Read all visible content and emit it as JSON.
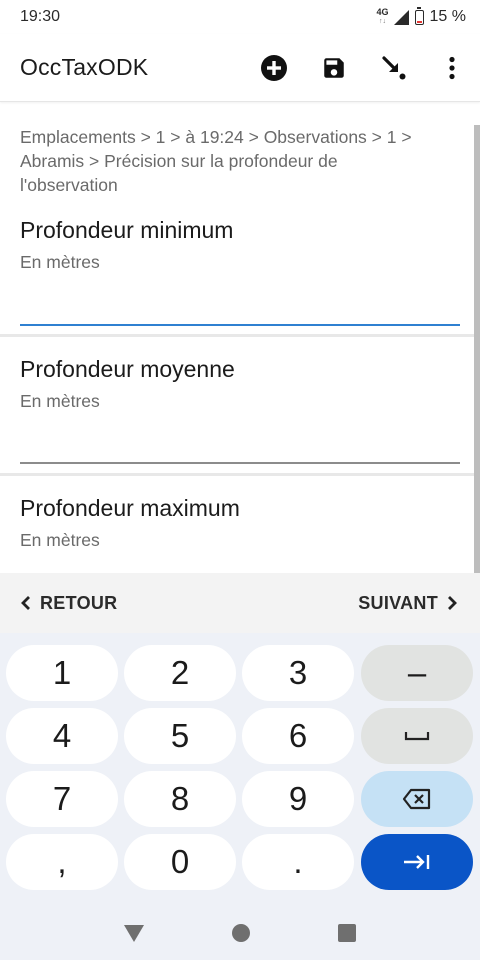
{
  "status_bar": {
    "time": "19:30",
    "network": "4G",
    "battery": "15 %",
    "battery_level": 0.15
  },
  "app_bar": {
    "title": "OccTaxODK",
    "actions": [
      "add-circle-icon",
      "save-icon",
      "jump-arrow-icon",
      "more-vert-icon"
    ]
  },
  "form": {
    "breadcrumb": "Emplacements > 1 > à 19:24 > Observations > 1 > Abramis > Précision sur la profondeur de l'observation",
    "questions": [
      {
        "label": "Profondeur minimum",
        "hint": "En mètres",
        "value": ""
      },
      {
        "label": "Profondeur moyenne",
        "hint": "En mètres",
        "value": ""
      },
      {
        "label": "Profondeur maximum",
        "hint": "En mètres",
        "value": ""
      }
    ]
  },
  "navigation": {
    "back_label": "RETOUR",
    "next_label": "SUIVANT"
  },
  "keypad": {
    "keys": [
      "1",
      "2",
      "3",
      "–",
      "4",
      "5",
      "6",
      "␣",
      "7",
      "8",
      "9",
      "⌫",
      ",",
      "0",
      ".",
      "⇥"
    ]
  },
  "colors": {
    "accent_blue": "#2f80d1",
    "enter_key": "#0a55c7",
    "backspace_key": "#c5e1f5",
    "battery_red": "#e53935"
  }
}
